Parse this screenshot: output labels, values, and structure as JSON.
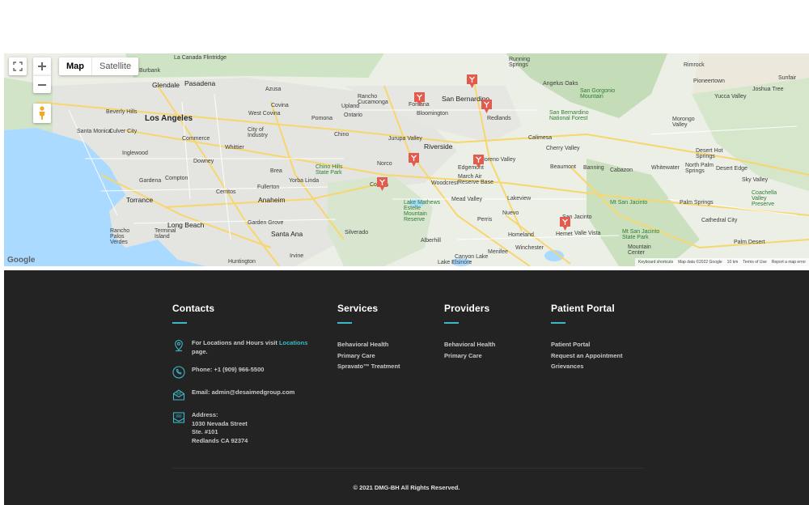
{
  "map": {
    "type_buttons": [
      "Map",
      "Satellite"
    ],
    "active_type": "Map",
    "places_big": [
      {
        "name": "Los Angeles",
        "id": "la"
      }
    ],
    "places": [
      "La Canada Flintridge",
      "Burbank",
      "Glendale",
      "Pasadena",
      "Azusa",
      "Rancho Cucamonga",
      "Upland",
      "Ontario",
      "San Bernardino",
      "Fontana",
      "Bloomington",
      "Redlands",
      "Running Springs",
      "Angelus Oaks",
      "San Gorgonio Mountain",
      "Rimrock",
      "Pioneertown",
      "Joshua Tree",
      "Sunfair",
      "Yucca Valley",
      "Morongo Valley",
      "Santa Monica",
      "Culver City",
      "Beverly Hills",
      "Commerce",
      "Whittier",
      "City of Industry",
      "West Covina",
      "Covina",
      "Pomona",
      "Chino",
      "Inglewood",
      "Downey",
      "Gardena",
      "Compton",
      "Cerritos",
      "Torrance",
      "Long Beach",
      "Fullerton",
      "Anaheim",
      "Yorba Linda",
      "Brea",
      "Garden Grove",
      "Santa Ana",
      "Irvine",
      "Huntington",
      "Rancho Palos Verdes",
      "Terminal Island",
      "Jurupa Valley",
      "Riverside",
      "Norco",
      "Corona",
      "Moreno Valley",
      "Edgemont",
      "March Air Reserve Base",
      "Woodcrest",
      "Mead Valley",
      "Lakeview",
      "Nuevo",
      "Perris",
      "Homeland",
      "Winchester",
      "Menifee",
      "Canyon Lake",
      "Lake Elsinore",
      "Silverado",
      "Alberhill",
      "Beaumont",
      "Banning",
      "Cabazon",
      "Whitewater",
      "North Palm Springs",
      "Desert Hot Springs",
      "Desert Edge",
      "Sky Valley",
      "Palm Springs",
      "Cathedral City",
      "Palm Desert",
      "San Jacinto",
      "Hemet",
      "Valle Vista",
      "Cherry Valley",
      "Calimesa",
      "Mountain Center",
      "Mt San Jacinto",
      "Mt San Jacinto State Park",
      "Chino Hills State Park",
      "Lake Mathews Estelle Mountain Reserve",
      "Coachella Valley Preserve",
      "San Bernardino National Forest"
    ],
    "google_label": "Google",
    "footer_links": [
      "Keyboard shortcuts",
      "Map data ©2022 Google",
      "10 km",
      "Terms of Use",
      "Report a map error"
    ]
  },
  "footer": {
    "contacts": {
      "title": "Contacts",
      "locations_prefix": "For Locations and Hours visit",
      "locations_link": "Locations",
      "locations_suffix": "page.",
      "phone": "Phone: +1 (909) 966-5500",
      "email": "Email: admin@desaimedgroup.com",
      "address_label": "Address:",
      "address_line1": "1030 Nevada Street",
      "address_line2": "Ste. #101",
      "address_line3": "Redlands CA 92374"
    },
    "services": {
      "title": "Services",
      "links": [
        "Behavioral Health",
        "Primary Care",
        "Spravato™ Treatment"
      ]
    },
    "providers": {
      "title": "Providers",
      "links": [
        "Behavioral Health",
        "Primary Care"
      ]
    },
    "patient_portal": {
      "title": "Patient Portal",
      "links": [
        "Patient Portal",
        "Request an Appointment",
        "Grievances"
      ]
    },
    "copyright": "© 2021 DMG-BH All Rights Reserved."
  },
  "colors": {
    "accent": "#3cb8c8",
    "footer_bg": "#232323",
    "marker": "#e35a4f"
  }
}
